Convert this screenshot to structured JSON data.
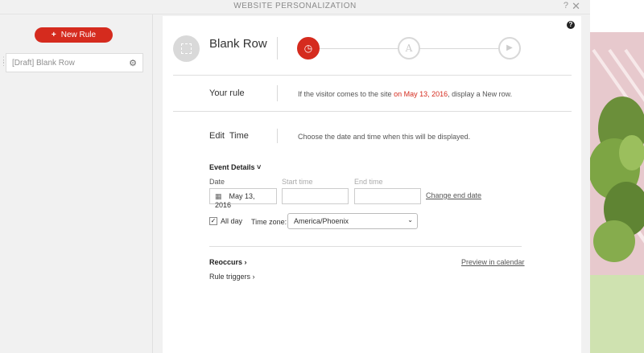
{
  "window": {
    "title": "WEBSITE PERSONALIZATION",
    "help_label": "?",
    "close_label": "✕"
  },
  "sidebar": {
    "new_rule_label": "New Rule",
    "rules": [
      {
        "label": "[Draft] Blank Row"
      }
    ]
  },
  "header": {
    "row_title": "Blank Row",
    "steps": [
      {
        "icon": "clock-icon",
        "glyph": "◷",
        "active": true
      },
      {
        "icon": "ab-test-icon",
        "glyph": "A",
        "active": false
      },
      {
        "icon": "play-icon",
        "glyph": "▶",
        "active": false
      }
    ]
  },
  "your_rule": {
    "label": "Your rule",
    "text_before": "If the visitor comes to the site ",
    "date_highlight": "on May 13, 2016",
    "text_after": ", display a New row."
  },
  "edit_time": {
    "label": "Edit  Time",
    "description": "Choose the date and time when this will be displayed."
  },
  "event_details": {
    "toggle_label": "Event Details ˅",
    "date_label": "Date",
    "date_value": "May 13, 2016",
    "start_time_label": "Start time",
    "start_time_value": "",
    "end_time_label": "End time",
    "end_time_value": "",
    "change_end_date_label": "Change end date",
    "all_day_label": "All day",
    "all_day_checked": true,
    "timezone_label": "Time zone:",
    "timezone_value": "America/Phoenix"
  },
  "footer_links": {
    "reoccurs_label": "Reoccurs ›",
    "preview_label": "Preview in calendar",
    "rule_triggers_label": "Rule triggers ›"
  },
  "colors": {
    "accent": "#d52b1e"
  }
}
